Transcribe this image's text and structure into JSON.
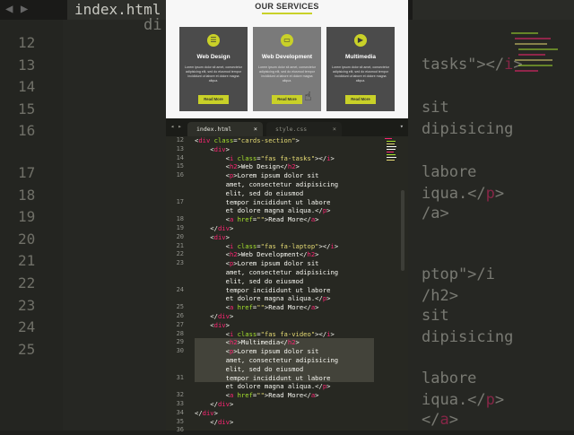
{
  "background": {
    "tab_label": "index.html",
    "line_numbers": [
      "12",
      "13",
      "14",
      "15",
      "16",
      "17",
      "18",
      "19",
      "20",
      "21",
      "22",
      "23",
      "24",
      "25"
    ],
    "code_fragments": [
      "<di",
      "tasks\"></i>",
      "sit",
      "dipisicing",
      "labore",
      "iqua.</p>",
      "/a>",
      "ptop\"></i",
      "/h2>",
      "sit",
      "dipisicing",
      "labore",
      "iqua.</p>",
      "</a>"
    ]
  },
  "preview": {
    "section_title": "OUR SERVICES",
    "cards": [
      {
        "title": "Web Design",
        "icon": "tasks-icon",
        "icon_glyph": "☰",
        "text": "Lorem ipsum dolor sit amet, consectetur adipisicing elit, sed do eiusmod tempor incididunt ut labore et dolore magna aliqua.",
        "button": "Read More"
      },
      {
        "title": "Web Development",
        "icon": "laptop-icon",
        "icon_glyph": "▭",
        "text": "Lorem ipsum dolor sit amet, consectetur adipisicing elit, sed do eiusmod tempor incididunt ut labore et dolore magna aliqua.",
        "button": "Read More"
      },
      {
        "title": "Multimedia",
        "icon": "video-icon",
        "icon_glyph": "▶",
        "text": "Lorem ipsum dolor sit amet, consectetur adipisicing elit, sed do eiusmod tempor incididunt ut labore et dolore magna aliqua.",
        "button": "Read More"
      }
    ],
    "accent_color": "#c9d128"
  },
  "editor": {
    "tabs": [
      {
        "label": "index.html",
        "close": "×"
      },
      {
        "label": "style.css",
        "close": "×"
      }
    ],
    "nav_arrows": "◂ ▸",
    "menu_glyph": "▾",
    "lines": [
      {
        "n": "12",
        "code": "        <div class=\"cards-section\">"
      },
      {
        "n": "13",
        "code": "            <div>"
      },
      {
        "n": "14",
        "code": "                <i class=\"fas fa-tasks\"></i>"
      },
      {
        "n": "15",
        "code": "                <h2>Web Design</h2>"
      },
      {
        "n": "16",
        "code": "                <p>Lorem ipsum dolor sit"
      },
      {
        "n": "",
        "code": "                amet, consectetur adipisicing"
      },
      {
        "n": "",
        "code": "                elit, sed do eiusmod"
      },
      {
        "n": "17",
        "code": "                tempor incididunt ut labore"
      },
      {
        "n": "",
        "code": "                et dolore magna aliqua.</p>"
      },
      {
        "n": "18",
        "code": "                <a href=\"\">Read More</a>"
      },
      {
        "n": "19",
        "code": "            </div>"
      },
      {
        "n": "20",
        "code": "            <div>"
      },
      {
        "n": "21",
        "code": "                <i class=\"fas fa-laptop\"></i>"
      },
      {
        "n": "22",
        "code": "                <h2>Web Development</h2>"
      },
      {
        "n": "23",
        "code": "                <p>Lorem ipsum dolor sit"
      },
      {
        "n": "",
        "code": "                amet, consectetur adipisicing"
      },
      {
        "n": "",
        "code": "                elit, sed do eiusmod"
      },
      {
        "n": "24",
        "code": "                tempor incididunt ut labore"
      },
      {
        "n": "",
        "code": "                et dolore magna aliqua.</p>"
      },
      {
        "n": "25",
        "code": "                <a href=\"\">Read More</a>"
      },
      {
        "n": "26",
        "code": "            </div>"
      },
      {
        "n": "27",
        "code": "            <div>"
      },
      {
        "n": "28",
        "code": "                <i class=\"fas fa-video\"></i>"
      },
      {
        "n": "29",
        "code": "                <h2>Multimedia</h2>"
      },
      {
        "n": "30",
        "code": "                <p>Lorem ipsum dolor sit"
      },
      {
        "n": "",
        "code": "                amet, consectetur adipisicing"
      },
      {
        "n": "",
        "code": "                elit, sed do eiusmod"
      },
      {
        "n": "31",
        "code": "                tempor incididunt ut labore"
      },
      {
        "n": "",
        "code": "                et dolore magna aliqua.</p>"
      },
      {
        "n": "32",
        "code": "                <a href=\"\">Read More</a>"
      },
      {
        "n": "33",
        "code": "            </div>"
      },
      {
        "n": "34",
        "code": "        </div>"
      },
      {
        "n": "35",
        "code": "    </div>"
      },
      {
        "n": "36",
        "code": ""
      }
    ]
  }
}
